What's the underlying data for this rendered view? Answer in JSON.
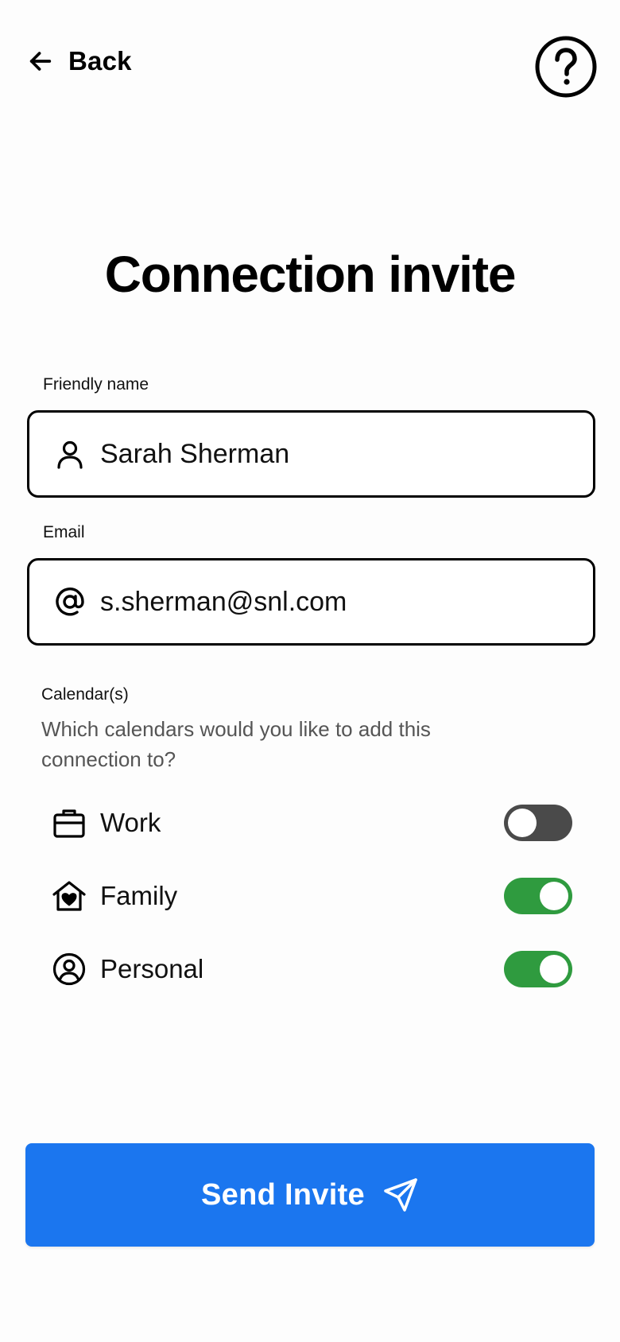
{
  "header": {
    "back_label": "Back",
    "back_icon": "arrow-left-icon",
    "help_icon": "question-circle-icon"
  },
  "title": "Connection invite",
  "friendly_name": {
    "label": "Friendly name",
    "value": "Sarah Sherman",
    "icon": "user-icon"
  },
  "email": {
    "label": "Email",
    "value": "s.sherman@snl.com",
    "icon": "at-sign-icon"
  },
  "calendars": {
    "label": "Calendar(s)",
    "description": "Which calendars would you like to add this connection to?",
    "items": [
      {
        "label": "Work",
        "icon": "briefcase-icon",
        "enabled": false
      },
      {
        "label": "Family",
        "icon": "home-heart-icon",
        "enabled": true
      },
      {
        "label": "Personal",
        "icon": "user-circle-icon",
        "enabled": true
      }
    ]
  },
  "send_button": {
    "label": "Send Invite",
    "icon": "send-icon"
  },
  "colors": {
    "primary": "#1b76ef",
    "toggle_on": "#2f9b3f",
    "toggle_off": "#4a4a4a"
  }
}
